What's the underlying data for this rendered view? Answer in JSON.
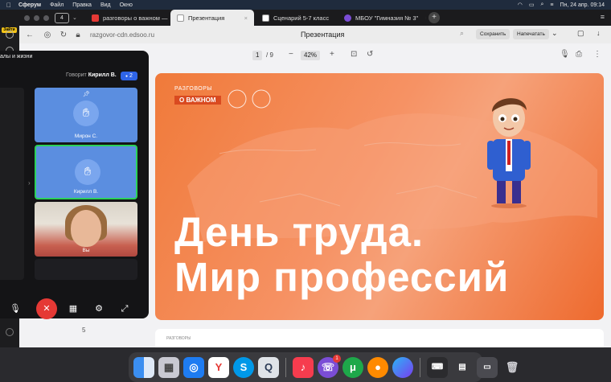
{
  "menubar": {
    "app": "Сферум",
    "items": [
      "Файл",
      "Правка",
      "Вид",
      "Окно"
    ],
    "datetime": "Пн, 24 апр.  09:14"
  },
  "tabs": {
    "count": "4",
    "items": [
      {
        "label": "разговоры о важном —",
        "color": "#e53935"
      },
      {
        "label": "Презентация",
        "color": "#ffffff"
      },
      {
        "label": "Сценарий 5-7 класс",
        "color": "#ffffff"
      },
      {
        "label": "МБОУ \"Гимназия № 3\"",
        "color": "#7b4dd6"
      }
    ]
  },
  "address": {
    "url": "razgovor-cdn.edsoo.ru",
    "page_title": "Презентация",
    "save_label": "Сохранить",
    "print_label": "Напечатать"
  },
  "pdf": {
    "page": "1",
    "total": "/ 9",
    "zoom": "42%",
    "next_page_number": "5"
  },
  "slide": {
    "logo_top": "РАЗГОВОРЫ",
    "logo_bottom": "О ВАЖНОМ",
    "headline_line1": "День труда.",
    "headline_line2": "Мир профессий",
    "page2_logo": "РАЗГОВОРЫ"
  },
  "call": {
    "title": "алы и жизни",
    "speaker_prefix": "Говорит",
    "speaker_name": "Кирилл В.",
    "participants_count": "2",
    "tiles": [
      {
        "name": "Мирон С."
      },
      {
        "name": "Кирилл В."
      },
      {
        "name": "Вы"
      }
    ]
  },
  "dock": {
    "viber_badge": "1",
    "apps": [
      "finder",
      "launchpad",
      "safari",
      "yandex",
      "skype",
      "quicktime",
      "music",
      "viber",
      "utorrent",
      "firefox",
      "browser",
      "keyboard",
      "screenshot",
      "chat",
      "trash"
    ]
  }
}
